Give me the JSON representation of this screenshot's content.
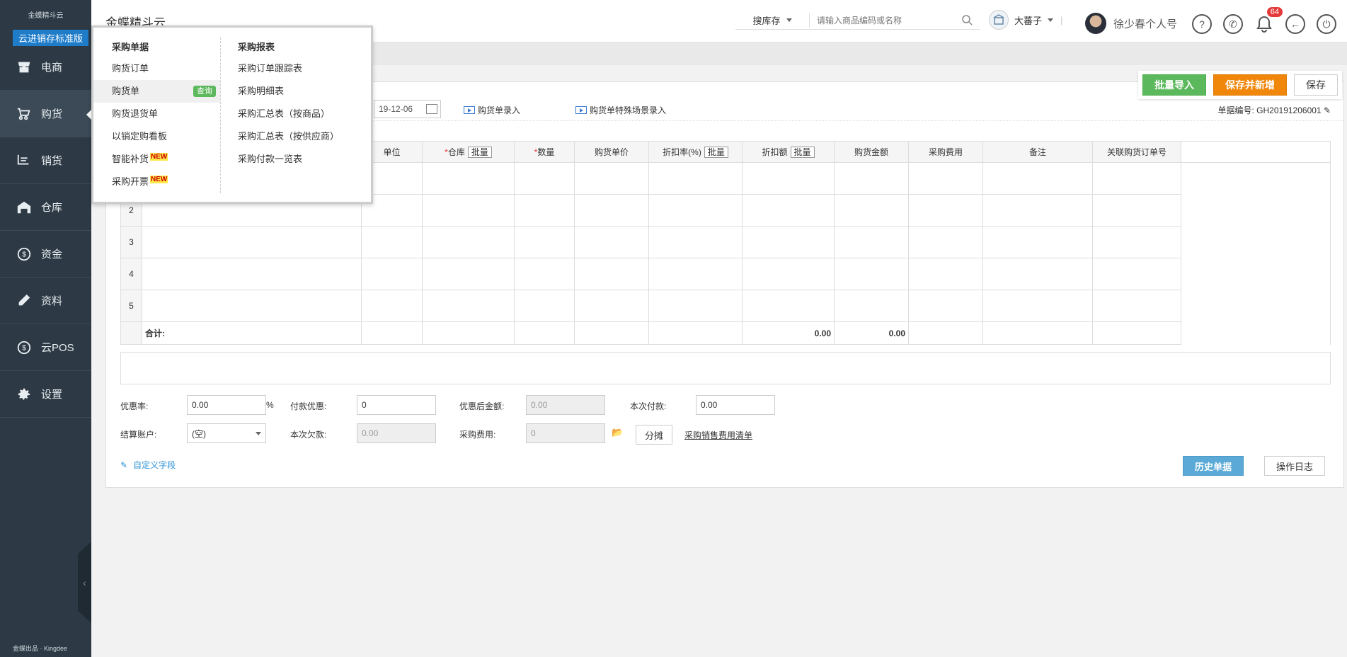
{
  "sidebar": {
    "logo": "金蝶精斗云",
    "edition": "云进销存标准版",
    "items": [
      {
        "label": "电商"
      },
      {
        "label": "购货"
      },
      {
        "label": "销货"
      },
      {
        "label": "仓库"
      },
      {
        "label": "资金"
      },
      {
        "label": "资料"
      },
      {
        "label": "云POS"
      },
      {
        "label": "设置"
      }
    ],
    "active_index": 1,
    "footer": "金蝶出品 · Kingdee",
    "collapse_glyph": "‹"
  },
  "header": {
    "title": "金蝶精斗云",
    "search_scope": "搜库存",
    "search_placeholder": "请输入商品编码或名称",
    "shop_name": "大蕃子",
    "user_name": "徐少春个人号",
    "notification_count": "64",
    "help_glyph": "?",
    "phone_glyph": "✆",
    "back_glyph": "←",
    "power_glyph": "⏻"
  },
  "toolbar": {
    "batch_import": "批量导入",
    "save_new": "保存并新增",
    "save": "保存"
  },
  "form": {
    "date": "19-12-06",
    "entry_link": "购货单录入",
    "special_link": "购货单特殊场景录入",
    "doc_no_label": "单据编号:",
    "doc_no": "GH20191206001"
  },
  "grid": {
    "columns": [
      "单位",
      "仓库",
      "数量",
      "购货单价",
      "折扣率(%)",
      "折扣额",
      "购货金额",
      "采购费用",
      "备注",
      "关联购货订单号"
    ],
    "batch_label": "批量",
    "rows": [
      "2",
      "3",
      "4",
      "5"
    ],
    "total_label": "合计:",
    "total_discount": "0.00",
    "total_amount": "0.00"
  },
  "summary": {
    "discount_rate_label": "优惠率:",
    "discount_rate": "0.00",
    "percent_sign": "%",
    "pay_discount_label": "付款优惠:",
    "pay_discount": "0",
    "after_discount_label": "优惠后金额:",
    "after_discount": "0.00",
    "this_payment_label": "本次付款:",
    "this_payment": "0.00",
    "account_label": "结算账户:",
    "account": "(空)",
    "this_debt_label": "本次欠款:",
    "this_debt": "0.00",
    "purchase_fee_label": "采购费用:",
    "purchase_fee": "0",
    "allocate_btn": "分摊",
    "fee_link": "采购销售费用清单",
    "custom_fields": "自定义字段",
    "history_btn": "历史单据",
    "log_btn": "操作日志"
  },
  "menu": {
    "left_title": "采购单据",
    "left_items": [
      "购货订单",
      "购货单",
      "购货退货单",
      "以销定购看板",
      "智能补货",
      "采购开票"
    ],
    "query_tag": "查询",
    "new_tag": "NEW",
    "right_title": "采购报表",
    "right_items": [
      "采购订单跟踪表",
      "采购明细表",
      "采购汇总表（按商品）",
      "采购汇总表（按供应商）",
      "采购付款一览表"
    ]
  }
}
